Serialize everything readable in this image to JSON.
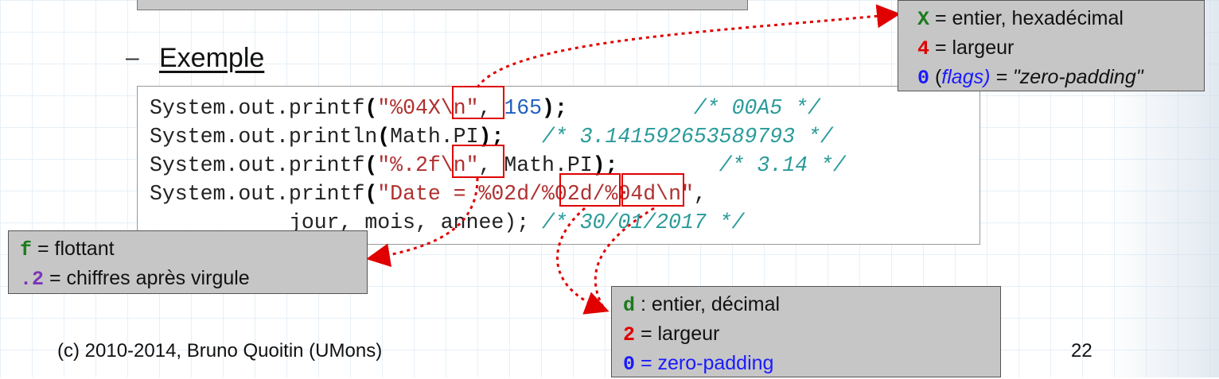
{
  "heading": {
    "bullet": "–",
    "label": "Exemple"
  },
  "code": {
    "line1": {
      "a": "System.out.printf",
      "p1": "(",
      "s1": "\"",
      "fmt": "%04X",
      "s2": "\\n\"",
      "sep": ", ",
      "num": "165",
      "p2": ");",
      "comment": "/* 00A5 */"
    },
    "line2": {
      "a": "System.out.println",
      "p1": "(",
      "arg": "Math.PI",
      "p2": ");",
      "comment": "/* 3.141592653589793 */"
    },
    "line3": {
      "a": "System.out.printf",
      "p1": "(",
      "s1": "\"",
      "fmt": "%.2f",
      "s2": "\\n\"",
      "sep": ", ",
      "arg": "Math.PI",
      "p2": ");",
      "comment": "/* 3.14 */"
    },
    "line4": {
      "a": "System.out.printf",
      "p1": "(",
      "s1": "\"Date = ",
      "fmt1": "%02d",
      "slash1": "/",
      "fmt2": "%02d",
      "rest": "/%04d\\n\"",
      "tail": ","
    },
    "line5": {
      "args": "jour, mois, annee",
      "p2": ");",
      "comment": "/* 30/01/2017 */"
    }
  },
  "note_x": {
    "code": "X",
    "code_text": " = entier, hexadécimal",
    "width": "4",
    "width_text": " = largeur",
    "flag": "0",
    "flag_open": " (",
    "flags_word": "flags)",
    "flag_text": " = \"zero-padding\""
  },
  "note_f": {
    "code": "f",
    "code_text": " = flottant",
    "prec": ".2",
    "prec_text": " = chiffres après virgule"
  },
  "note_d": {
    "code": "d",
    "code_text": " : entier, décimal",
    "width": "2",
    "width_text": " = largeur",
    "flag": "0",
    "flag_text": " = zero-padding"
  },
  "footer": {
    "credit": "(c) 2010-2014, Bruno Quoitin (UMons)",
    "page": "22"
  },
  "colors": {
    "highlight": "#e00000",
    "note_bg": "#c6c6c6",
    "code_string": "#b03030",
    "code_number": "#1f5fbf",
    "code_comment": "#2a9a9a"
  }
}
